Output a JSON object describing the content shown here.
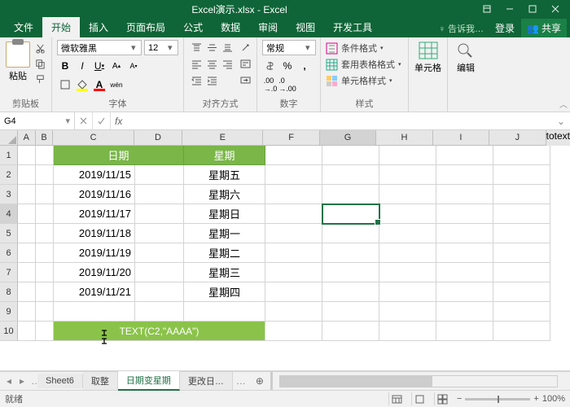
{
  "title": "Excel演示.xlsx - Excel",
  "menutabs": [
    "文件",
    "开始",
    "插入",
    "页面布局",
    "公式",
    "数据",
    "审阅",
    "视图",
    "开发工具"
  ],
  "activeTab": 1,
  "tellme": "告诉我…",
  "login": "登录",
  "share": "共享",
  "ribbon": {
    "paste": "粘贴",
    "clipboard": "剪贴板",
    "font_name": "微软雅黑",
    "font_size": "12",
    "font": "字体",
    "align": "对齐方式",
    "wrap": "",
    "number_format": "常规",
    "number": "数字",
    "cond_format": "条件格式",
    "table_format": "套用表格格式",
    "cell_style": "单元格样式",
    "styles": "样式",
    "cells": "单元格",
    "editing": "编辑"
  },
  "namebox": "G4",
  "formula": "",
  "cols": [
    "A",
    "B",
    "C",
    "D",
    "E",
    "F",
    "G",
    "H",
    "I",
    "J"
  ],
  "rows": [
    "1",
    "2",
    "3",
    "4",
    "5",
    "6",
    "7",
    "8",
    "9",
    "10"
  ],
  "headers": {
    "date": "日期",
    "weekday": "星期"
  },
  "table": [
    {
      "date": "2019/11/15",
      "wd": "星期五"
    },
    {
      "date": "2019/11/16",
      "wd": "星期六"
    },
    {
      "date": "2019/11/17",
      "wd": "星期日"
    },
    {
      "date": "2019/11/18",
      "wd": "星期一"
    },
    {
      "date": "2019/11/19",
      "wd": "星期二"
    },
    {
      "date": "2019/11/20",
      "wd": "星期三"
    },
    {
      "date": "2019/11/21",
      "wd": "星期四"
    }
  ],
  "formula_display": "TEXT(C2,\"AAAA\")",
  "sheets": [
    "Sheet6",
    "取整",
    "日期变星期",
    "更改日…"
  ],
  "activeSheet": 2,
  "status": "就绪",
  "zoom": "100%",
  "activeCell": "G4"
}
